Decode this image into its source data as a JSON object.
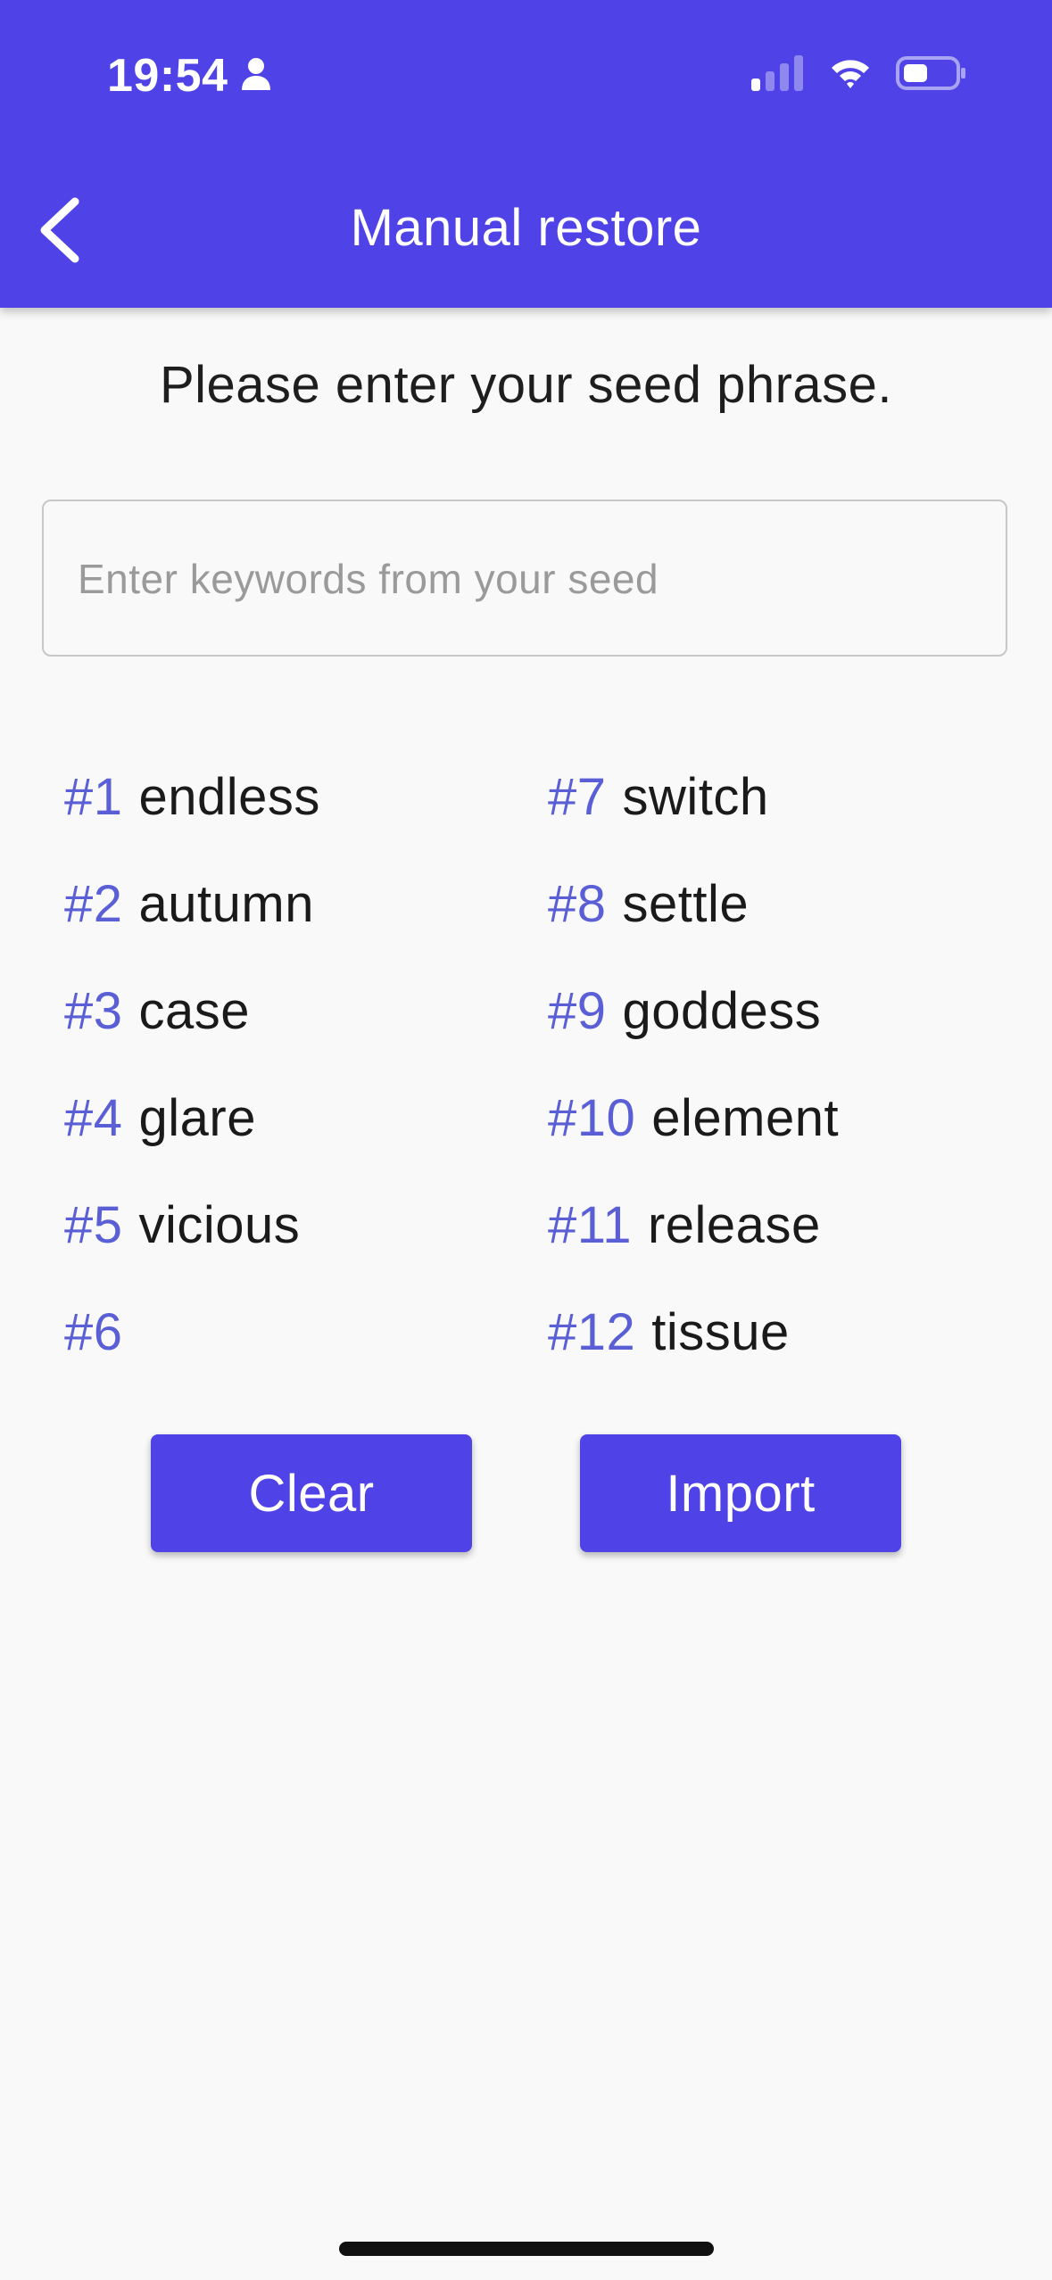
{
  "status_bar": {
    "time": "19:54"
  },
  "header": {
    "title": "Manual restore",
    "color": "#4f43e8"
  },
  "instruction": "Please enter your seed phrase.",
  "search": {
    "placeholder": "Enter keywords from your seed",
    "value": ""
  },
  "seed_words": [
    {
      "index": "#1",
      "word": "endless"
    },
    {
      "index": "#2",
      "word": "autumn"
    },
    {
      "index": "#3",
      "word": "case"
    },
    {
      "index": "#4",
      "word": "glare"
    },
    {
      "index": "#5",
      "word": "vicious"
    },
    {
      "index": "#6",
      "word": ""
    },
    {
      "index": "#7",
      "word": "switch"
    },
    {
      "index": "#8",
      "word": "settle"
    },
    {
      "index": "#9",
      "word": "goddess"
    },
    {
      "index": "#10",
      "word": "element"
    },
    {
      "index": "#11",
      "word": "release"
    },
    {
      "index": "#12",
      "word": "tissue"
    }
  ],
  "buttons": {
    "clear": "Clear",
    "import": "Import"
  },
  "colors": {
    "accent": "#4f43e8",
    "index_text": "#5a5fd6",
    "background": "#f9f9f9"
  }
}
